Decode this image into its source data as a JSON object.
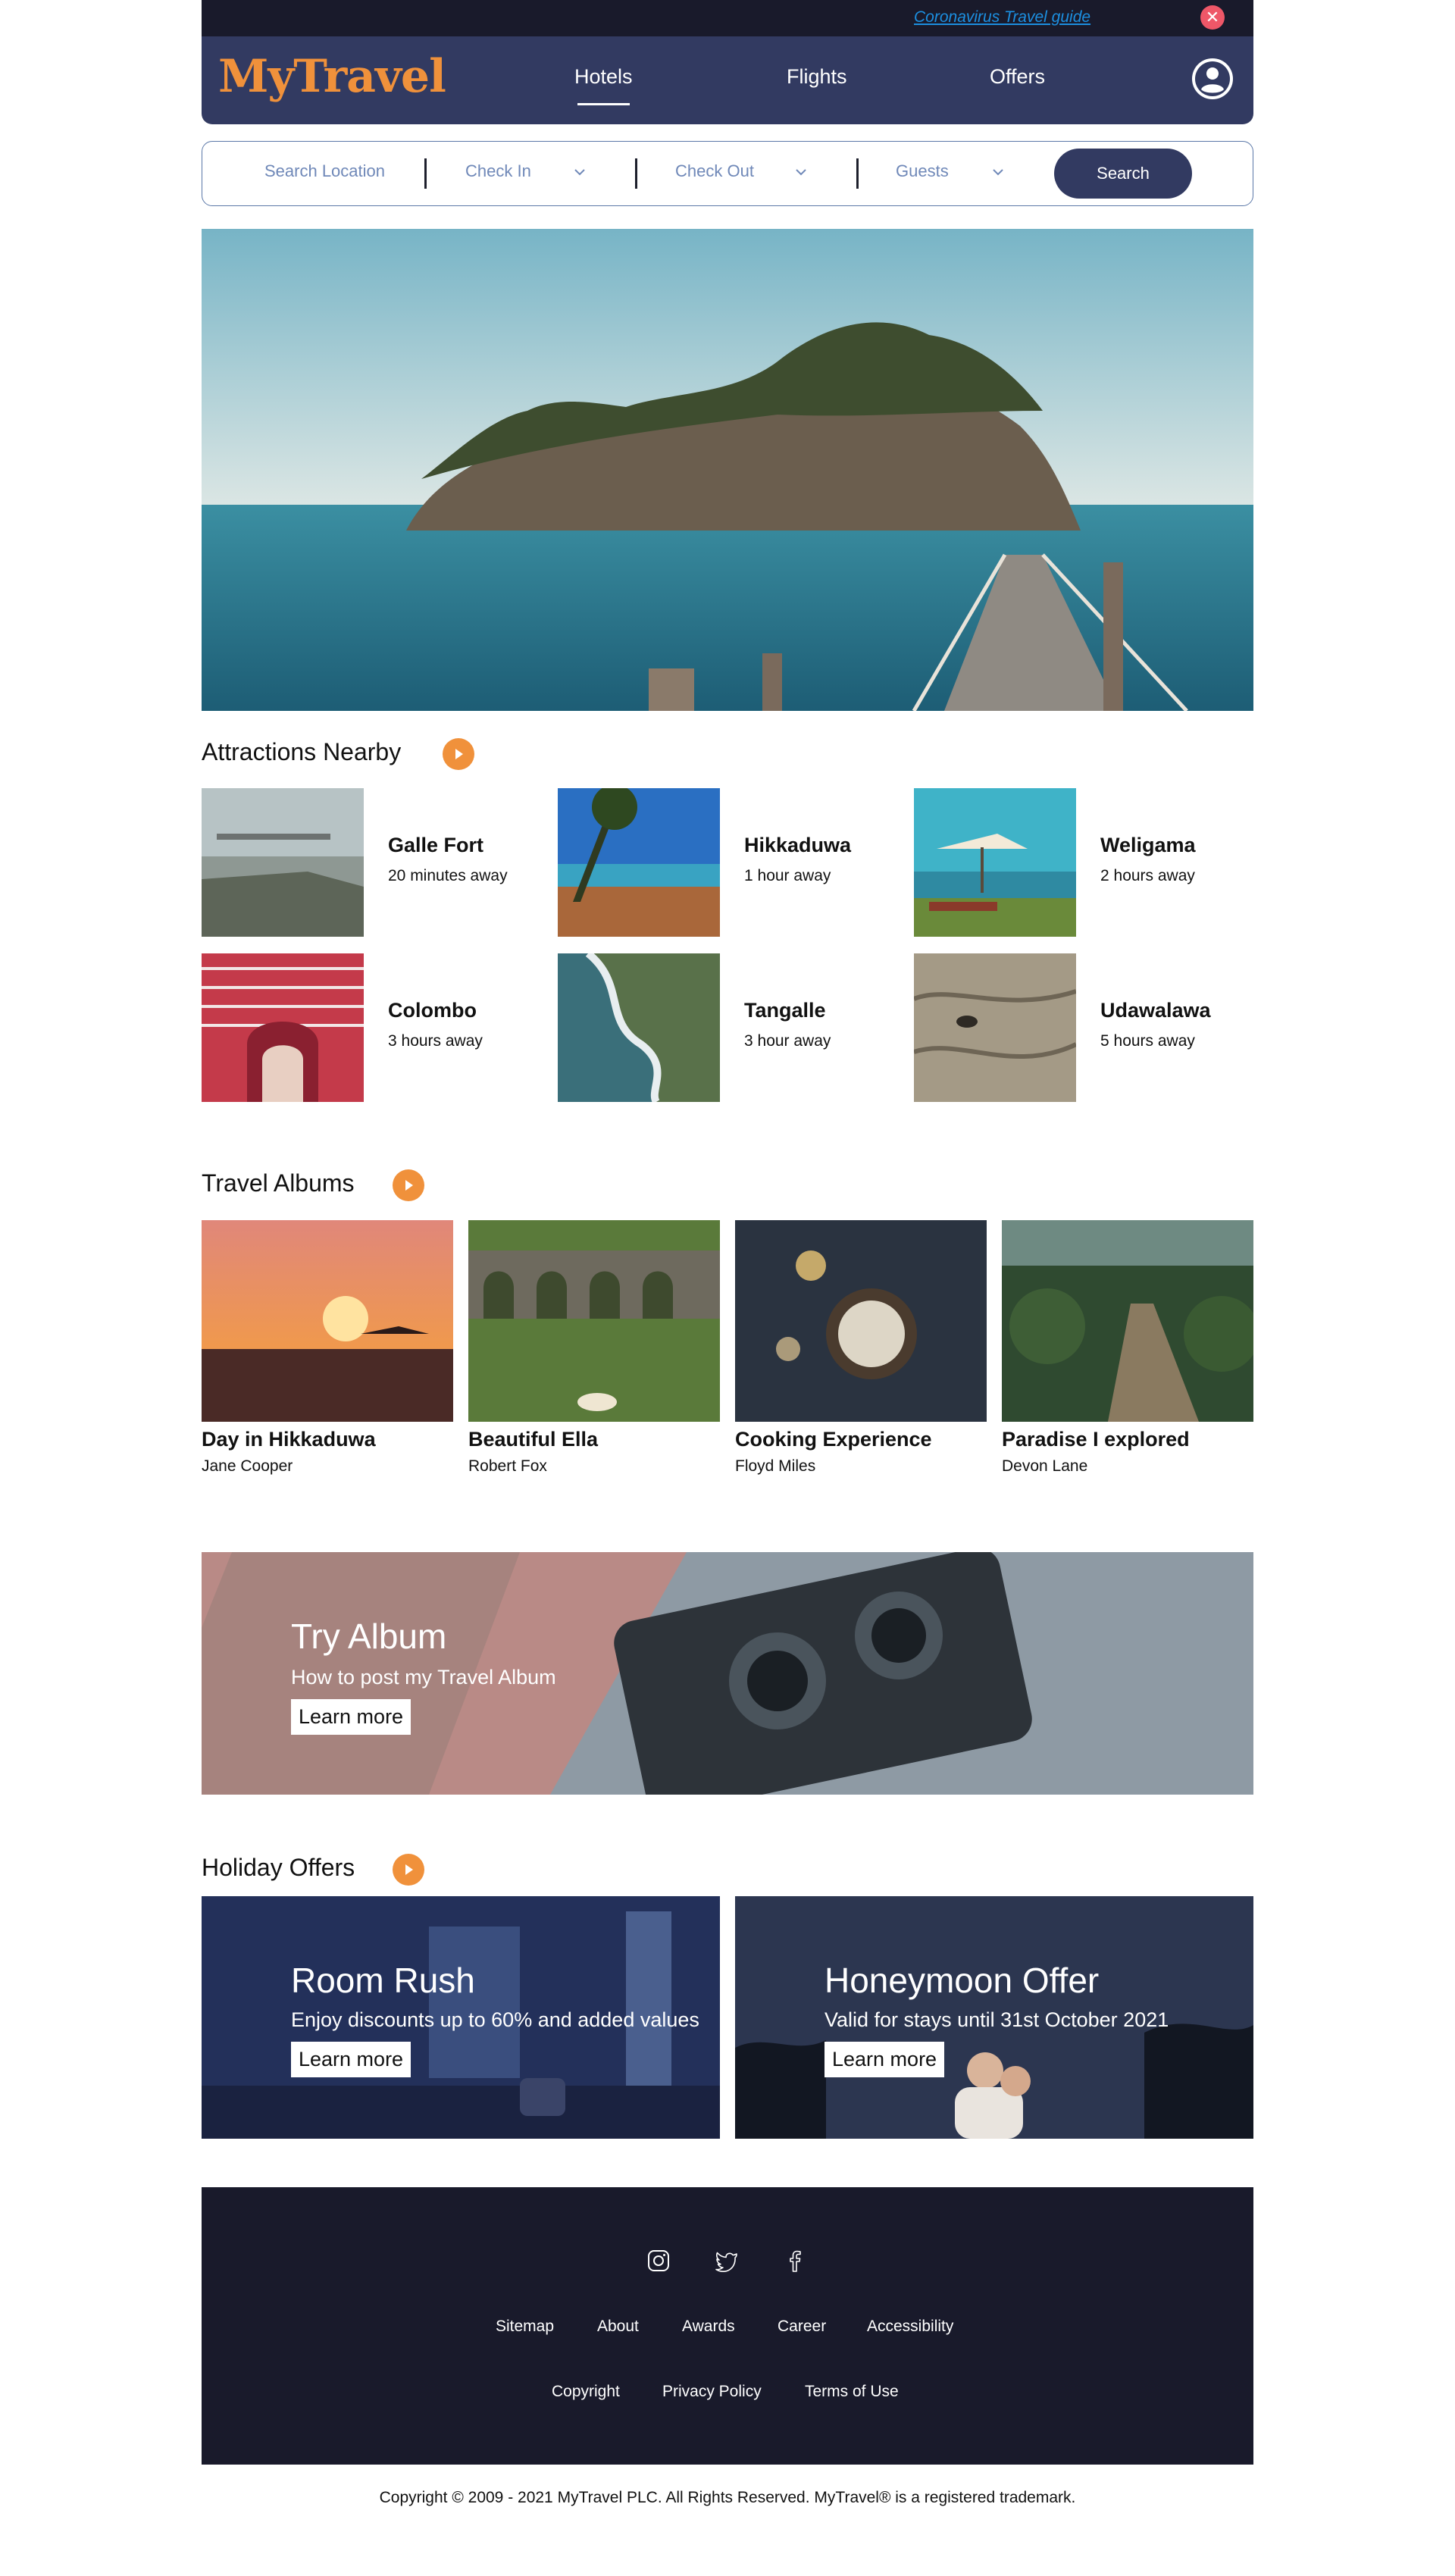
{
  "topbar": {
    "guide_link": "Coronavirus Travel guide",
    "close_icon": "close-icon"
  },
  "nav": {
    "logo": "MyTravel",
    "links": [
      "Hotels",
      "Flights",
      "Offers"
    ],
    "active": "Hotels",
    "account_icon": "user-icon"
  },
  "search": {
    "location": "Search Location",
    "check_in": "Check In",
    "check_out": "Check Out",
    "guests": "Guests",
    "button": "Search"
  },
  "attractions": {
    "title": "Attractions Nearby",
    "items": [
      {
        "name": "Galle Fort",
        "distance": "20 minutes away"
      },
      {
        "name": "Hikkaduwa",
        "distance": "1 hour away"
      },
      {
        "name": "Weligama",
        "distance": "2 hours away"
      },
      {
        "name": "Colombo",
        "distance": "3 hours away"
      },
      {
        "name": "Tangalle",
        "distance": "3 hour away"
      },
      {
        "name": "Udawalawa",
        "distance": "5 hours away"
      }
    ]
  },
  "albums": {
    "title": "Travel Albums",
    "items": [
      {
        "title": "Day in Hikkaduwa",
        "author": "Jane Cooper"
      },
      {
        "title": "Beautiful Ella",
        "author": "Robert Fox"
      },
      {
        "title": "Cooking Experience",
        "author": "Floyd Miles"
      },
      {
        "title": "Paradise I explored",
        "author": "Devon Lane"
      }
    ]
  },
  "try_album": {
    "title": "Try Album",
    "subtitle": "How to post my Travel Album",
    "button": "Learn more"
  },
  "offers": {
    "title": "Holiday Offers",
    "items": [
      {
        "title": "Room Rush",
        "subtitle": "Enjoy discounts up to 60% and added values",
        "button": "Learn more"
      },
      {
        "title": "Honeymoon Offer",
        "subtitle": "Valid for stays until 31st October 2021",
        "button": "Learn more"
      }
    ]
  },
  "footer": {
    "social": [
      "instagram-icon",
      "twitter-icon",
      "facebook-icon"
    ],
    "links_row1": [
      "Sitemap",
      "About",
      "Awards",
      "Career",
      "Accessibility"
    ],
    "links_row2": [
      "Copyright",
      "Privacy Policy",
      "Terms of Use"
    ]
  },
  "copyright": "Copyright © 2009 - 2021 MyTravel PLC. All Rights Reserved. MyTravel® is a registered trademark.",
  "colors": {
    "navy": "#323a61",
    "dark": "#191a2b",
    "accent": "#f0913b",
    "close": "#ee5768"
  }
}
